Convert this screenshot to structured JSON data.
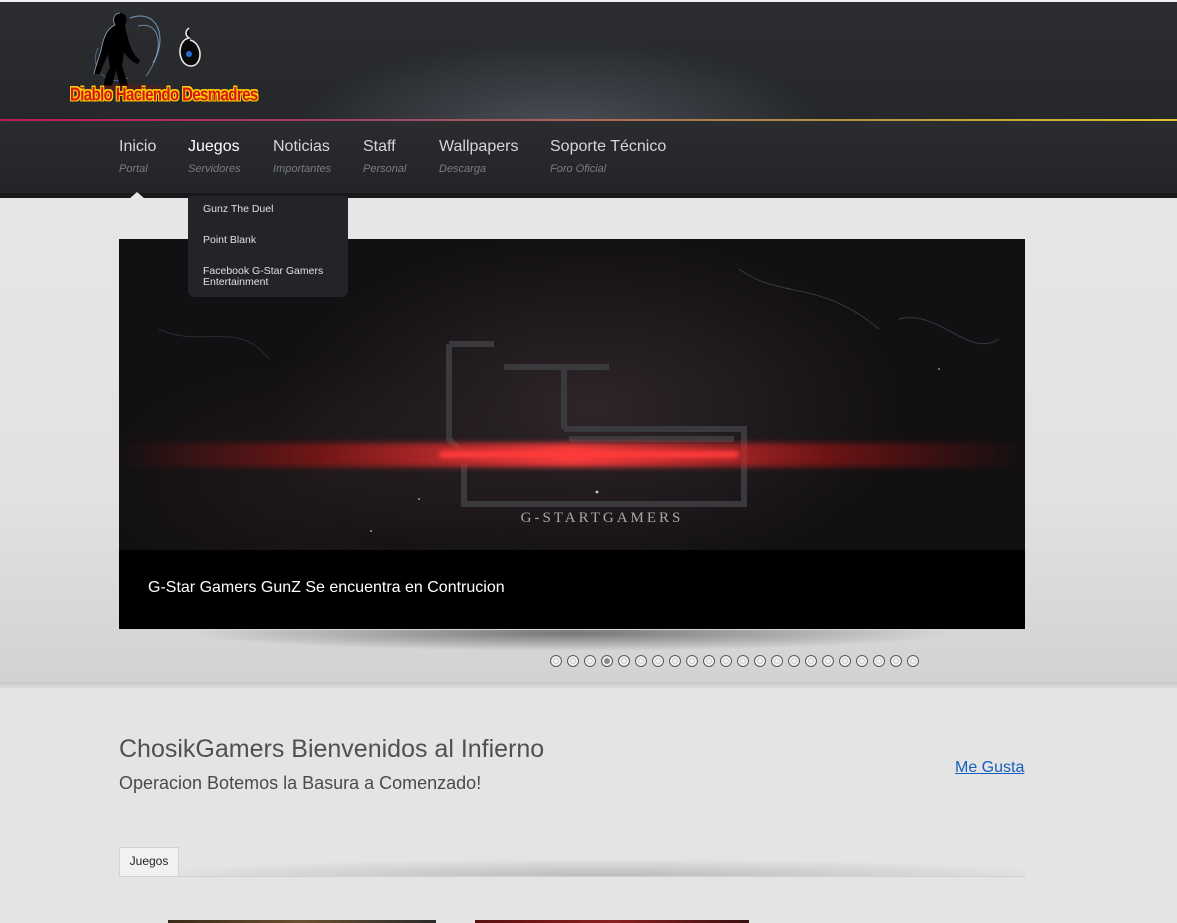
{
  "header": {
    "logo_text": "Diablo Haciendo Desmadres"
  },
  "nav": {
    "items": [
      {
        "label": "Inicio",
        "sub": "Portal"
      },
      {
        "label": "Juegos",
        "sub": "Servidores"
      },
      {
        "label": "Noticias",
        "sub": "Importantes"
      },
      {
        "label": "Staff",
        "sub": "Personal"
      },
      {
        "label": "Wallpapers",
        "sub": "Descarga"
      },
      {
        "label": "Soporte Técnico",
        "sub": "Foro Oficial"
      }
    ],
    "active_index": 1,
    "dropdown": [
      "Gunz The Duel",
      "Point Blank",
      "Facebook G-Star Gamers Entertainment"
    ]
  },
  "slider": {
    "image_text": "G-STARTGAMERS",
    "caption": "G-Star Gamers GunZ Se encuentra en Contrucion",
    "slide_count": 22,
    "active_slide": 4
  },
  "main": {
    "title": "ChosikGamers Bienvenidos al Infierno",
    "subtitle": "Operacion Botemos la Basura a Comenzado!",
    "like_link": "Me Gusta",
    "tabs": [
      "Juegos"
    ]
  },
  "colors": {
    "header_bg": "#26282b",
    "accent_rule_start": "#c2185b",
    "accent_rule_end": "#e0c030",
    "link": "#1560bd",
    "beam_red": "#ff3b3b"
  },
  "icons": [
    "demon-silhouette-icon",
    "devil-tail-icon"
  ]
}
